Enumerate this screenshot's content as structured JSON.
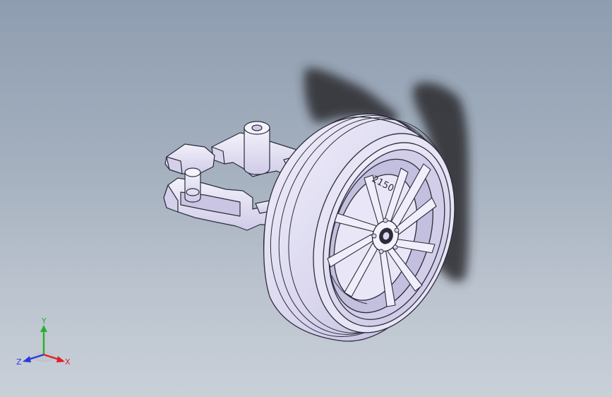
{
  "viewport": {
    "background_top": "#8e9db0",
    "background_bottom": "#c9d0d8",
    "model_fill": "#e8e6f6",
    "model_edge": "#2c2c3a",
    "shadow_color": "#2a2a2e"
  },
  "triad": {
    "x_label": "X",
    "y_label": "Y",
    "z_label": "Z",
    "x_color": "#e0202a",
    "y_color": "#26b030",
    "z_color": "#2a3ae0"
  },
  "model": {
    "name_icon": "wheel-assembly-icon",
    "rim_marking": "2150"
  }
}
